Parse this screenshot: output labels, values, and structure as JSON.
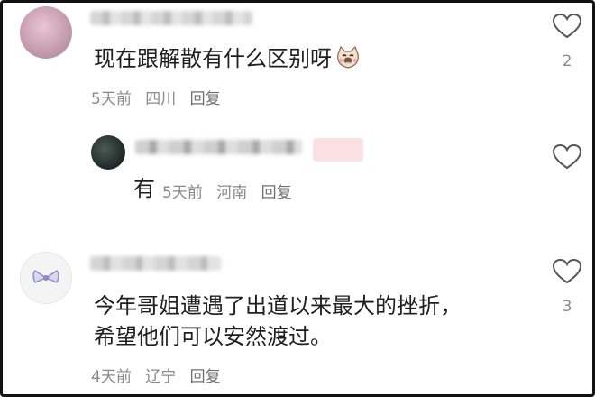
{
  "comments": [
    {
      "text": "现在跟解散有什么区别呀",
      "emoji": "cat-emoji",
      "meta": {
        "time": "5天前",
        "location": "四川",
        "reply": "回复"
      },
      "likes": "2"
    },
    {
      "text": "有",
      "meta": {
        "time": "5天前",
        "location": "河南",
        "reply": "回复"
      }
    },
    {
      "text_line1": "今年哥姐遭遇了出道以来最大的挫折，",
      "text_line2": "希望他们可以安然渡过。",
      "meta": {
        "time": "4天前",
        "location": "辽宁",
        "reply": "回复"
      },
      "likes": "3"
    }
  ],
  "colors": {
    "meta": "#8a8a8a",
    "text": "#1f1f1f",
    "heart_stroke": "#555555"
  }
}
